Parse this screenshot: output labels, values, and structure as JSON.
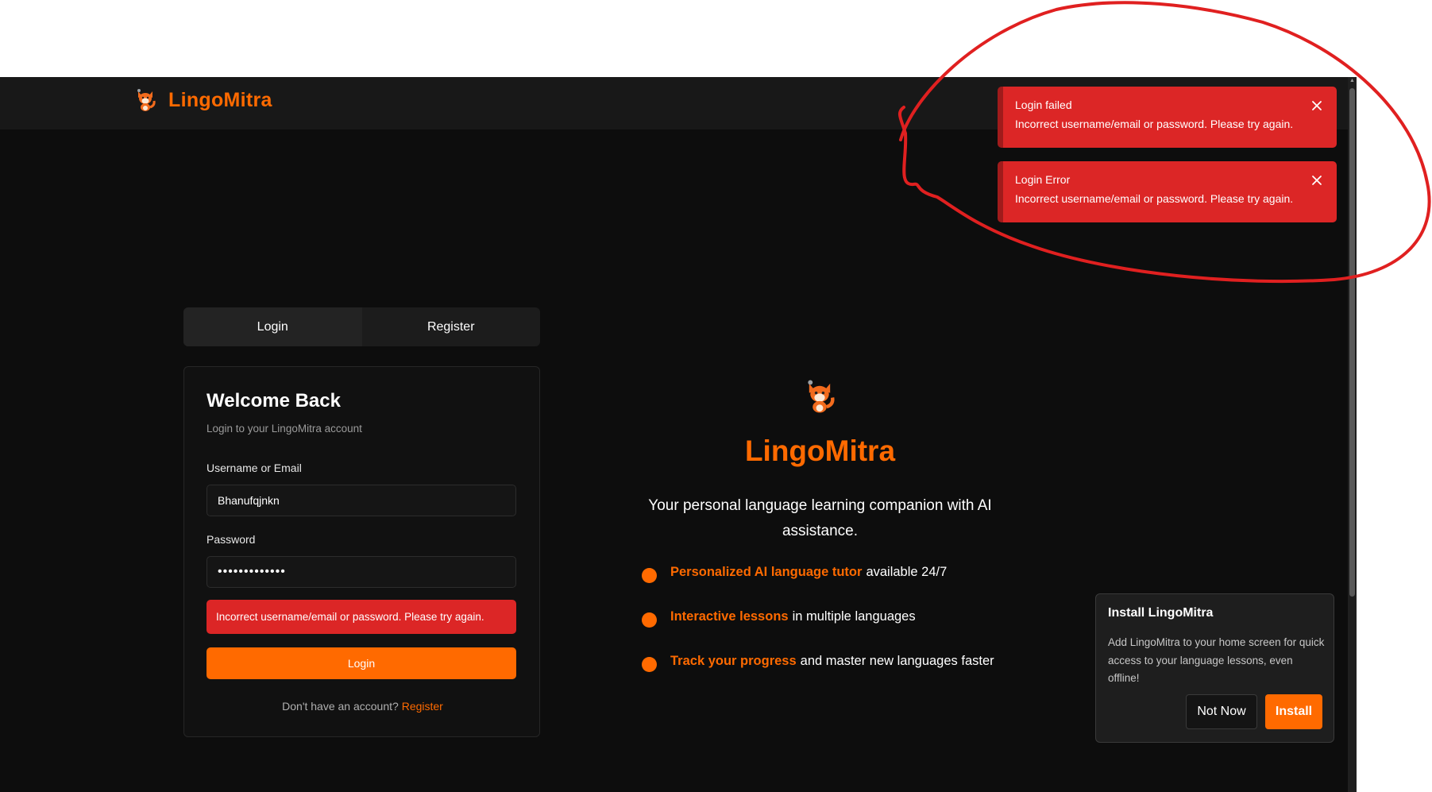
{
  "header": {
    "brand": "LingoMitra",
    "logo_icon": "fox-mascot-icon"
  },
  "tabs": [
    {
      "label": "Login",
      "active": true
    },
    {
      "label": "Register",
      "active": false
    }
  ],
  "login_card": {
    "title": "Welcome Back",
    "subtitle": "Login to your LingoMitra account",
    "username_label": "Username or Email",
    "username_value": "Bhanufqjnkn",
    "password_label": "Password",
    "password_value": "•••••••••••••",
    "error": "Incorrect username/email or password. Please try again.",
    "login_button": "Login",
    "register_prompt": "Don't have an account?",
    "register_link": "Register"
  },
  "hero": {
    "title": "LingoMitra",
    "tagline": "Your personal language learning companion with AI assistance.",
    "features": [
      {
        "highlight": "Personalized AI language tutor",
        "rest": "available 24/7"
      },
      {
        "highlight": "Interactive lessons",
        "rest": "in multiple languages"
      },
      {
        "highlight": "Track your progress",
        "rest": "and master new languages faster"
      }
    ]
  },
  "toasts": [
    {
      "title": "Login failed",
      "message": "Incorrect username/email or password. Please try again."
    },
    {
      "title": "Login Error",
      "message": "Incorrect username/email or password. Please try again."
    }
  ],
  "install_prompt": {
    "title": "Install LingoMitra",
    "description": "Add LingoMitra to your home screen for quick access to your language lessons, even offline!",
    "not_now": "Not Now",
    "install": "Install"
  },
  "colors": {
    "accent": "#ff6a00",
    "error": "#dc2626",
    "background": "#0d0d0d",
    "annotation": "#e02020"
  }
}
